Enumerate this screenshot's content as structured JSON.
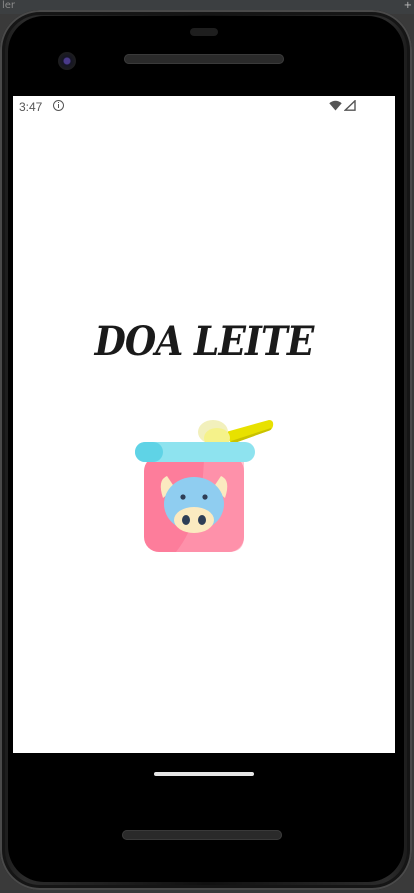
{
  "desktop": {
    "strip_text": "ler",
    "strip_plus": "+"
  },
  "status_bar": {
    "time": "3:47",
    "icons": [
      "info-icon",
      "wifi-icon",
      "signal-icon"
    ]
  },
  "app": {
    "title": "DOA LEITE",
    "logo_icon": "milk-powder-can-icon",
    "colors": {
      "can_body": "#fd7d9b",
      "can_lid": "#8ee3ef",
      "scoop": "#e8e100",
      "cow_face": "#8fcdf0",
      "cow_snout": "#fbeac0"
    }
  },
  "navigation": {
    "home_indicator": "home-gesture-bar"
  }
}
